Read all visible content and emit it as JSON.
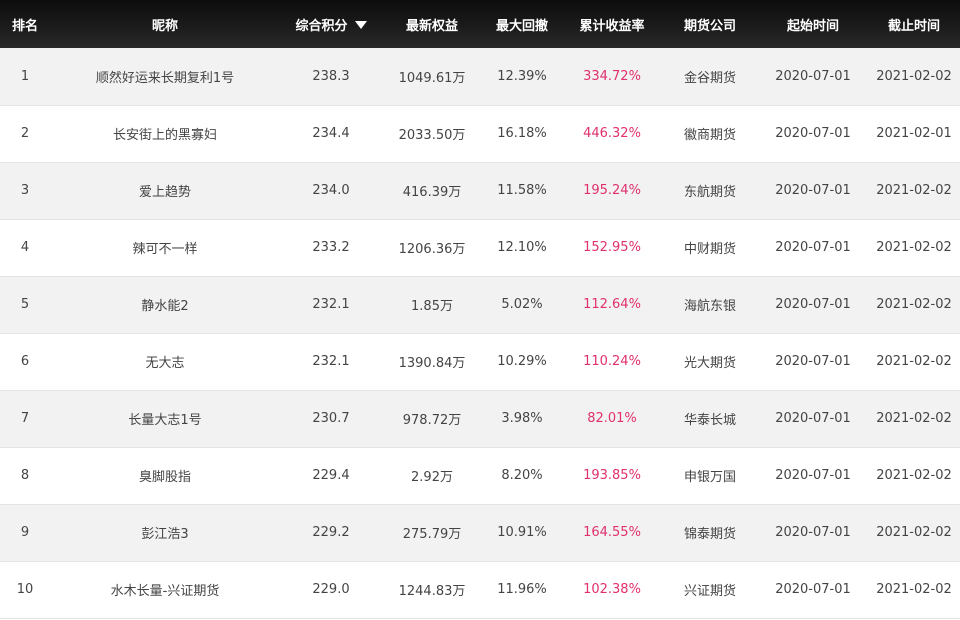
{
  "header": {
    "rank": "排名",
    "nickname": "昵称",
    "score": "综合积分",
    "equity": "最新权益",
    "drawdown": "最大回撤",
    "yield": "累计收益率",
    "company": "期货公司",
    "start": "起始时间",
    "end": "截止时间"
  },
  "colors": {
    "header_bg": "#1a1a1a",
    "yield_text": "#e0306e",
    "row_alt": "#f2f2f2"
  },
  "rows": [
    {
      "rank": "1",
      "nickname": "顺然好运来长期复利1号",
      "score": "238.3",
      "equity": "1049.61万",
      "drawdown": "12.39%",
      "yield": "334.72%",
      "company": "金谷期货",
      "start": "2020-07-01",
      "end": "2021-02-02"
    },
    {
      "rank": "2",
      "nickname": "长安街上的黑寡妇",
      "score": "234.4",
      "equity": "2033.50万",
      "drawdown": "16.18%",
      "yield": "446.32%",
      "company": "徽商期货",
      "start": "2020-07-01",
      "end": "2021-02-01"
    },
    {
      "rank": "3",
      "nickname": "爱上趋势",
      "score": "234.0",
      "equity": "416.39万",
      "drawdown": "11.58%",
      "yield": "195.24%",
      "company": "东航期货",
      "start": "2020-07-01",
      "end": "2021-02-02"
    },
    {
      "rank": "4",
      "nickname": "辣可不一样",
      "score": "233.2",
      "equity": "1206.36万",
      "drawdown": "12.10%",
      "yield": "152.95%",
      "company": "中财期货",
      "start": "2020-07-01",
      "end": "2021-02-02"
    },
    {
      "rank": "5",
      "nickname": "静水能2",
      "score": "232.1",
      "equity": "1.85万",
      "drawdown": "5.02%",
      "yield": "112.64%",
      "company": "海航东银",
      "start": "2020-07-01",
      "end": "2021-02-02"
    },
    {
      "rank": "6",
      "nickname": "无大志",
      "score": "232.1",
      "equity": "1390.84万",
      "drawdown": "10.29%",
      "yield": "110.24%",
      "company": "光大期货",
      "start": "2020-07-01",
      "end": "2021-02-02"
    },
    {
      "rank": "7",
      "nickname": "长量大志1号",
      "score": "230.7",
      "equity": "978.72万",
      "drawdown": "3.98%",
      "yield": "82.01%",
      "company": "华泰长城",
      "start": "2020-07-01",
      "end": "2021-02-02"
    },
    {
      "rank": "8",
      "nickname": "臭脚股指",
      "score": "229.4",
      "equity": "2.92万",
      "drawdown": "8.20%",
      "yield": "193.85%",
      "company": "申银万国",
      "start": "2020-07-01",
      "end": "2021-02-02"
    },
    {
      "rank": "9",
      "nickname": "彭江浩3",
      "score": "229.2",
      "equity": "275.79万",
      "drawdown": "10.91%",
      "yield": "164.55%",
      "company": "锦泰期货",
      "start": "2020-07-01",
      "end": "2021-02-02"
    },
    {
      "rank": "10",
      "nickname": "水木长量-兴证期货",
      "score": "229.0",
      "equity": "1244.83万",
      "drawdown": "11.96%",
      "yield": "102.38%",
      "company": "兴证期货",
      "start": "2020-07-01",
      "end": "2021-02-02"
    }
  ]
}
